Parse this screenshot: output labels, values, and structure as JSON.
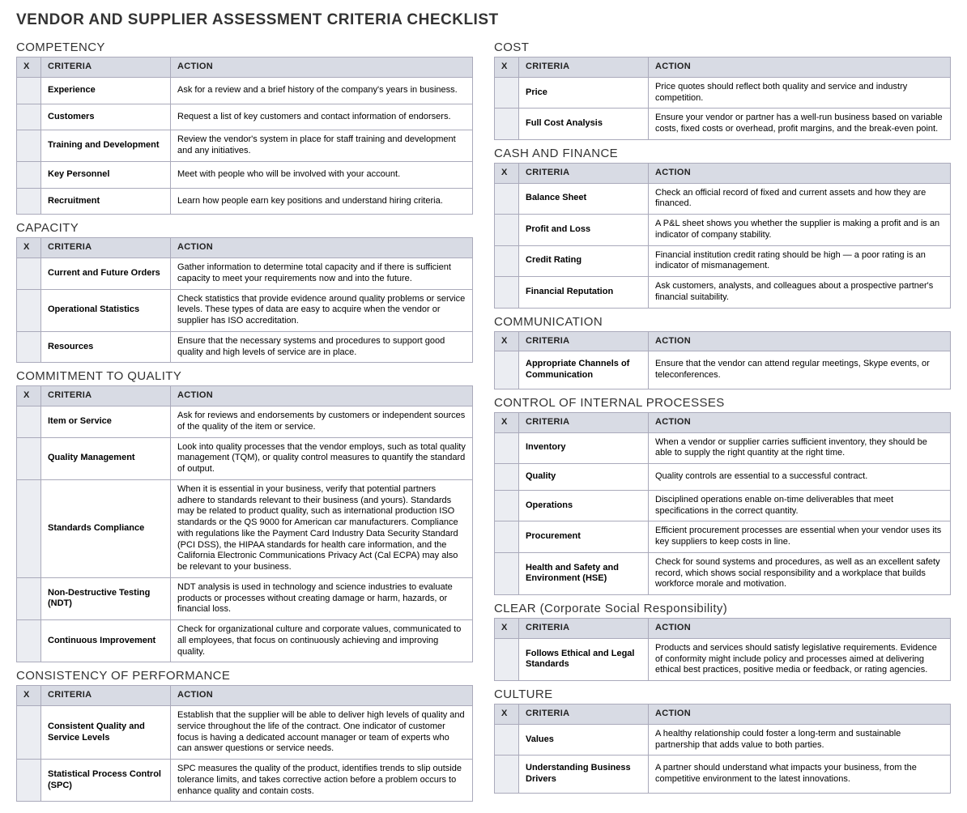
{
  "title": "VENDOR AND SUPPLIER ASSESSMENT CRITERIA CHECKLIST",
  "headers": {
    "x": "X",
    "criteria": "CRITERIA",
    "action": "ACTION"
  },
  "left": [
    {
      "name": "COMPETENCY",
      "rows": [
        {
          "criteria": "Experience",
          "action": "Ask for a review and a brief history of the company's years in business."
        },
        {
          "criteria": "Customers",
          "action": "Request a list of key customers and contact information of endorsers."
        },
        {
          "criteria": "Training and Development",
          "action": "Review the vendor's system in place for staff training and development and any initiatives."
        },
        {
          "criteria": "Key Personnel",
          "action": "Meet with people who will be involved with your account."
        },
        {
          "criteria": "Recruitment",
          "action": "Learn how people earn key positions and understand hiring criteria."
        }
      ]
    },
    {
      "name": "CAPACITY",
      "rows": [
        {
          "criteria": "Current and Future Orders",
          "action": "Gather information to determine total capacity and if there is sufficient capacity to meet your requirements now and into the future."
        },
        {
          "criteria": "Operational Statistics",
          "action": "Check statistics that provide evidence around quality problems or service levels. These types of data are easy to acquire when the vendor or supplier has ISO accreditation."
        },
        {
          "criteria": "Resources",
          "action": "Ensure that the necessary systems and procedures to support good quality and high levels of service are in place."
        }
      ]
    },
    {
      "name": "COMMITMENT TO QUALITY",
      "rows": [
        {
          "criteria": "Item or Service",
          "action": "Ask for reviews and endorsements by customers or independent sources of the quality of the item or service."
        },
        {
          "criteria": "Quality Management",
          "action": "Look into quality processes that the vendor employs, such as total quality management (TQM), or quality control measures to quantify the standard of output."
        },
        {
          "criteria": "Standards Compliance",
          "action": "When it is essential in your business, verify that potential partners adhere to standards relevant to their business (and yours). Standards may be related to product quality, such as international production ISO standards or the QS 9000 for American car manufacturers. Compliance with regulations like the Payment Card Industry Data Security Standard (PCI DSS), the HIPAA standards for health care information, and the California Electronic Communications Privacy Act (Cal ECPA) may also be relevant to your business."
        },
        {
          "criteria": "Non-Destructive Testing (NDT)",
          "action": "NDT analysis is used in technology and science industries to evaluate products or processes without creating damage or harm, hazards, or financial loss."
        },
        {
          "criteria": "Continuous Improvement",
          "action": "Check for organizational culture and corporate values, communicated to all employees, that focus on continuously achieving and improving quality."
        }
      ]
    },
    {
      "name": "CONSISTENCY OF PERFORMANCE",
      "rows": [
        {
          "criteria": "Consistent Quality and Service Levels",
          "action": "Establish that the supplier will be able to deliver high levels of quality and service throughout the life of the contract. One indicator of customer focus is having a dedicated account manager or team of experts who can answer questions or service needs."
        },
        {
          "criteria": "Statistical Process Control (SPC)",
          "action": "SPC measures the quality of the product, identifies trends to slip outside tolerance limits, and takes corrective action before a problem occurs to enhance quality and contain costs."
        }
      ]
    }
  ],
  "right": [
    {
      "name": "COST",
      "rows": [
        {
          "criteria": "Price",
          "action": "Price quotes should reflect both quality and service and industry competition."
        },
        {
          "criteria": "Full Cost Analysis",
          "action": "Ensure your vendor or partner has a well-run business based on variable costs, fixed costs or overhead, profit margins, and the break-even point."
        }
      ]
    },
    {
      "name": "CASH AND FINANCE",
      "rows": [
        {
          "criteria": "Balance Sheet",
          "action": "Check an official record of fixed and current assets and how they are financed."
        },
        {
          "criteria": "Profit and Loss",
          "action": "A P&L sheet shows you whether the supplier is making a profit and is an indicator of company stability."
        },
        {
          "criteria": "Credit Rating",
          "action": "Financial institution credit rating should be high — a poor rating is an indicator of mismanagement."
        },
        {
          "criteria": "Financial Reputation",
          "action": "Ask customers, analysts, and colleagues about a prospective partner's financial suitability."
        }
      ]
    },
    {
      "name": "COMMUNICATION",
      "rows": [
        {
          "criteria": "Appropriate Channels of Communication",
          "action": "Ensure that the vendor can attend regular meetings, Skype events, or teleconferences."
        }
      ]
    },
    {
      "name": "CONTROL OF INTERNAL PROCESSES",
      "rows": [
        {
          "criteria": "Inventory",
          "action": "When a vendor or supplier carries sufficient inventory, they should be able to supply the right quantity at the right time."
        },
        {
          "criteria": "Quality",
          "action": "Quality controls are essential to a successful contract."
        },
        {
          "criteria": "Operations",
          "action": "Disciplined operations enable on-time deliverables that meet specifications in the correct quantity."
        },
        {
          "criteria": "Procurement",
          "action": "Efficient procurement processes are essential when your vendor uses its key suppliers to keep costs in line."
        },
        {
          "criteria": "Health and Safety and Environment (HSE)",
          "action": "Check for sound systems and procedures, as well as an excellent safety record, which shows social responsibility and a workplace that builds workforce morale and motivation."
        }
      ]
    },
    {
      "name": "CLEAR (Corporate Social Responsibility)",
      "rows": [
        {
          "criteria": "Follows Ethical and Legal Standards",
          "action": "Products and services should satisfy legislative requirements. Evidence of conformity might include policy and processes aimed at delivering ethical best practices, positive media or feedback, or rating agencies."
        }
      ]
    },
    {
      "name": "CULTURE",
      "rows": [
        {
          "criteria": "Values",
          "action": "A healthy relationship could foster a long-term and sustainable partnership that adds value to both parties."
        },
        {
          "criteria": "Understanding Business Drivers",
          "action": "A partner should understand what impacts your business, from the competitive environment to the latest innovations."
        }
      ]
    }
  ]
}
